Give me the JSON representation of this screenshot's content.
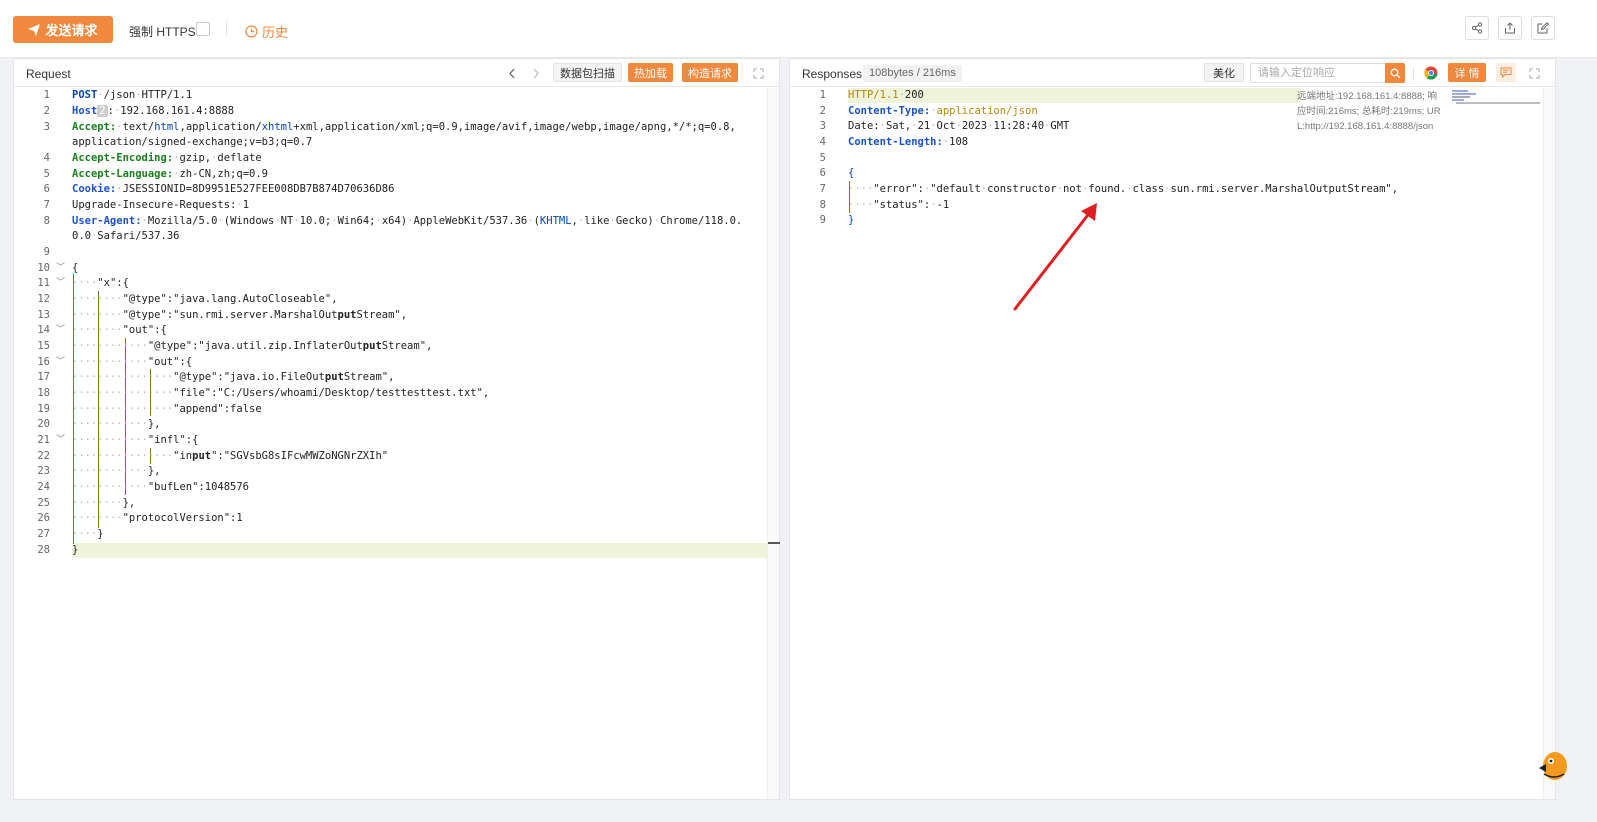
{
  "toolbar": {
    "send_label": "发送请求",
    "https_label": "强制 HTTPS",
    "history_label": "历史"
  },
  "request": {
    "title": "Request",
    "scan_label": "数据包扫描",
    "hotload_label": "热加载",
    "build_label": "构造请求"
  },
  "response": {
    "title": "Responses",
    "size_time": "108bytes / 216ms",
    "beautify_label": "美化",
    "search_placeholder": "请输入定位响应",
    "detail_label": "详 情",
    "meta_remote": "远端地址:192.168.161.4:8888; 响",
    "meta_time": "应时间:216ms; 总耗时:219ms; UR",
    "meta_url": "L:http://192.168.161.4:8888/json"
  },
  "icons": [
    "paper-plane-icon",
    "clock-icon",
    "share-icon",
    "export-icon",
    "edit-icon",
    "chevron-left-icon",
    "chevron-right-icon",
    "expand-icon",
    "search-icon",
    "chrome-icon",
    "comment-icon",
    "mascot-icon"
  ],
  "colors": {
    "accent": "#f0883e",
    "highlight": "#eef3da",
    "guide_red": "#d84040"
  }
}
